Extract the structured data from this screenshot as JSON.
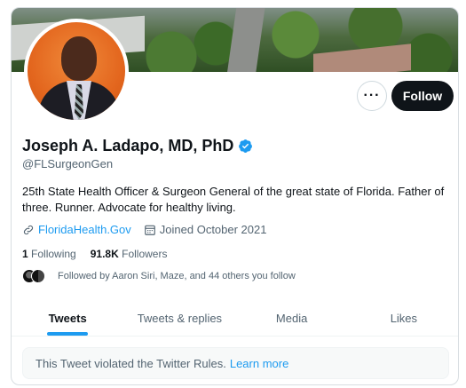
{
  "profile": {
    "name": "Joseph A. Ladapo, MD, PhD",
    "handle": "@FLSurgeonGen",
    "bio": "25th State Health Officer & Surgeon General of the great state of Florida. Father of three. Runner. Advocate for healthy living.",
    "website": "FloridaHealth.Gov",
    "joined": "Joined October 2021",
    "verified_icon": "verified-badge-icon",
    "accent_color": "#1d9bf0"
  },
  "actions": {
    "more_label": "···",
    "follow_label": "Follow"
  },
  "stats": {
    "following_count": "1",
    "following_label": "Following",
    "followers_count": "91.8K",
    "followers_label": "Followers"
  },
  "followed_by": "Followed by Aaron Siri, Maze, and 44 others you follow",
  "tabs": [
    {
      "label": "Tweets",
      "active": true
    },
    {
      "label": "Tweets & replies",
      "active": false
    },
    {
      "label": "Media",
      "active": false
    },
    {
      "label": "Likes",
      "active": false
    }
  ],
  "notice": {
    "text": "This Tweet violated the Twitter Rules.",
    "link": "Learn more"
  }
}
